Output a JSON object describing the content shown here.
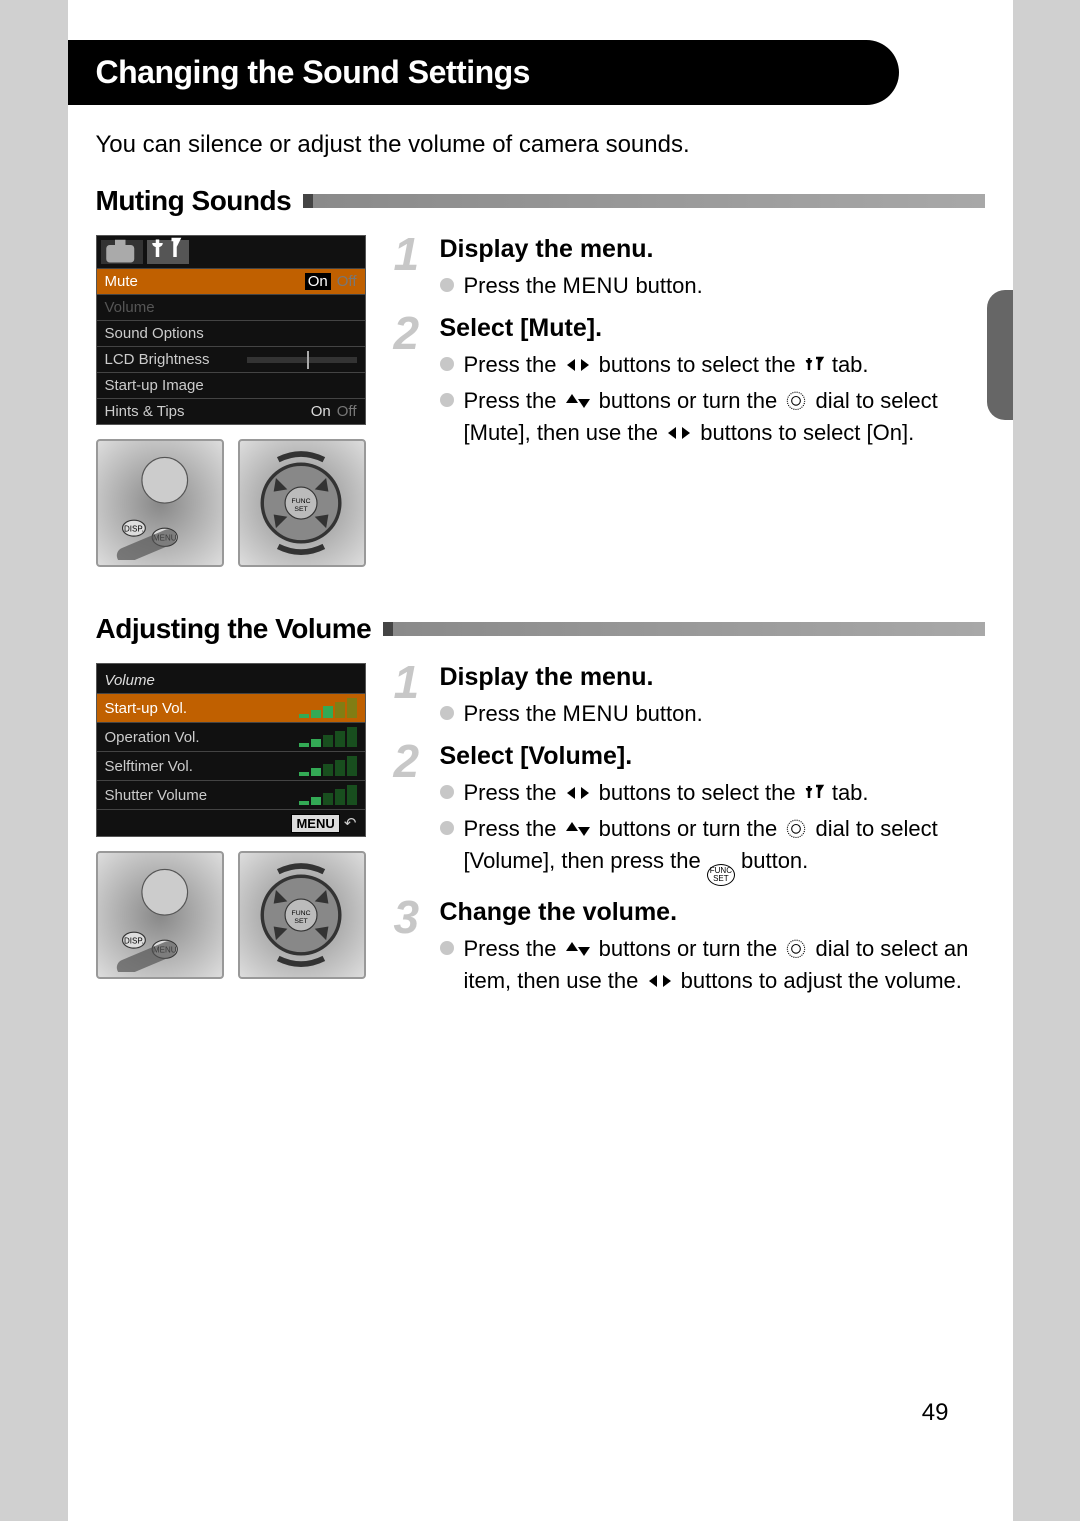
{
  "title": "Changing the Sound Settings",
  "intro": "You can silence or adjust the volume of camera sounds.",
  "page_number": "49",
  "muting": {
    "heading": "Muting Sounds",
    "lcd": {
      "menu": {
        "mute": {
          "label": "Mute",
          "on": "On",
          "off": "Off"
        },
        "volume": "Volume",
        "sound_options": "Sound Options",
        "lcd_brightness": "LCD Brightness",
        "startup_image": "Start-up Image",
        "hints": {
          "label": "Hints & Tips",
          "on": "On",
          "off": "Off"
        }
      }
    },
    "steps": {
      "s1": {
        "num": "1",
        "title": "Display the menu.",
        "b1_pre": "Press the ",
        "b1_menu": "MENU",
        "b1_post": " button."
      },
      "s2": {
        "num": "2",
        "title": "Select [Mute].",
        "b1_a": "Press the ",
        "b1_b": " buttons to select the ",
        "b1_c": " tab.",
        "b2_a": "Press the ",
        "b2_b": " buttons or turn the ",
        "b2_c": " dial to select [Mute], then use the ",
        "b2_d": " buttons to select [On]."
      }
    }
  },
  "adjusting": {
    "heading": "Adjusting the Volume",
    "lcd": {
      "title": "Volume",
      "rows": {
        "startup": "Start-up Vol.",
        "operation": "Operation Vol.",
        "selftimer": "Selftimer Vol.",
        "shutter": "Shutter Volume"
      },
      "foot": "MENU"
    },
    "steps": {
      "s1": {
        "num": "1",
        "title": "Display the menu.",
        "b1_pre": "Press the ",
        "b1_menu": "MENU",
        "b1_post": " button."
      },
      "s2": {
        "num": "2",
        "title": "Select [Volume].",
        "b1_a": "Press the ",
        "b1_b": " buttons to select the ",
        "b1_c": " tab.",
        "b2_a": "Press the ",
        "b2_b": " buttons or turn the ",
        "b2_c": " dial to select [Volume], then press the ",
        "b2_d": " button."
      },
      "s3": {
        "num": "3",
        "title": "Change the volume.",
        "b1_a": "Press the ",
        "b1_b": " buttons or turn the ",
        "b1_c": " dial to select an item, then use the ",
        "b1_d": " buttons to adjust the volume."
      }
    }
  }
}
